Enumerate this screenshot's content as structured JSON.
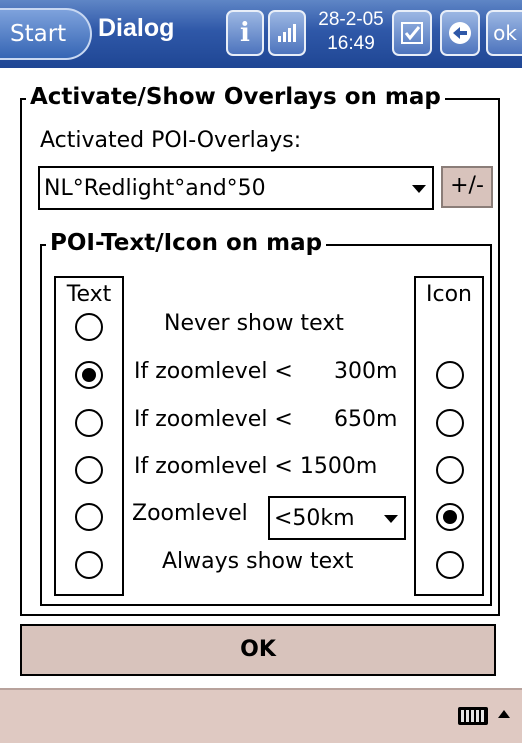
{
  "titlebar": {
    "start_label": "Start",
    "title": "Dialog",
    "info_icon": "i",
    "date": "28-2-05",
    "time": "16:49",
    "ok_label": "ok"
  },
  "overlays": {
    "group_title": "Activate/Show Overlays on map",
    "activated_label": "Activated POI-Overlays:",
    "selected_overlay": "NL°Redlight°and°50",
    "plus_minus_label": "+/-"
  },
  "poi_group": {
    "group_title": "POI-Text/Icon on map",
    "text_header": "Text",
    "icon_header": "Icon",
    "rows": [
      {
        "label": "Never show text",
        "value": "",
        "text_on": false,
        "icon_visible": false,
        "icon_on": false
      },
      {
        "label": "If zoomlevel <",
        "value": "300m",
        "text_on": true,
        "icon_visible": true,
        "icon_on": false
      },
      {
        "label": "If zoomlevel <",
        "value": "650m",
        "text_on": false,
        "icon_visible": true,
        "icon_on": false
      },
      {
        "label": "If zoomlevel < 1500m",
        "value": "",
        "text_on": false,
        "icon_visible": true,
        "icon_on": false
      },
      {
        "label": "Zoomlevel",
        "value": "",
        "text_on": false,
        "icon_visible": true,
        "icon_on": true
      },
      {
        "label": "Always show text",
        "value": "",
        "text_on": false,
        "icon_visible": true,
        "icon_on": false
      }
    ],
    "zoom_select": "<50km"
  },
  "ok_button": "OK",
  "icons": [
    "info-icon",
    "signal-icon",
    "checkbox-icon",
    "back-icon",
    "keyboard-icon",
    "up-arrow-icon"
  ]
}
